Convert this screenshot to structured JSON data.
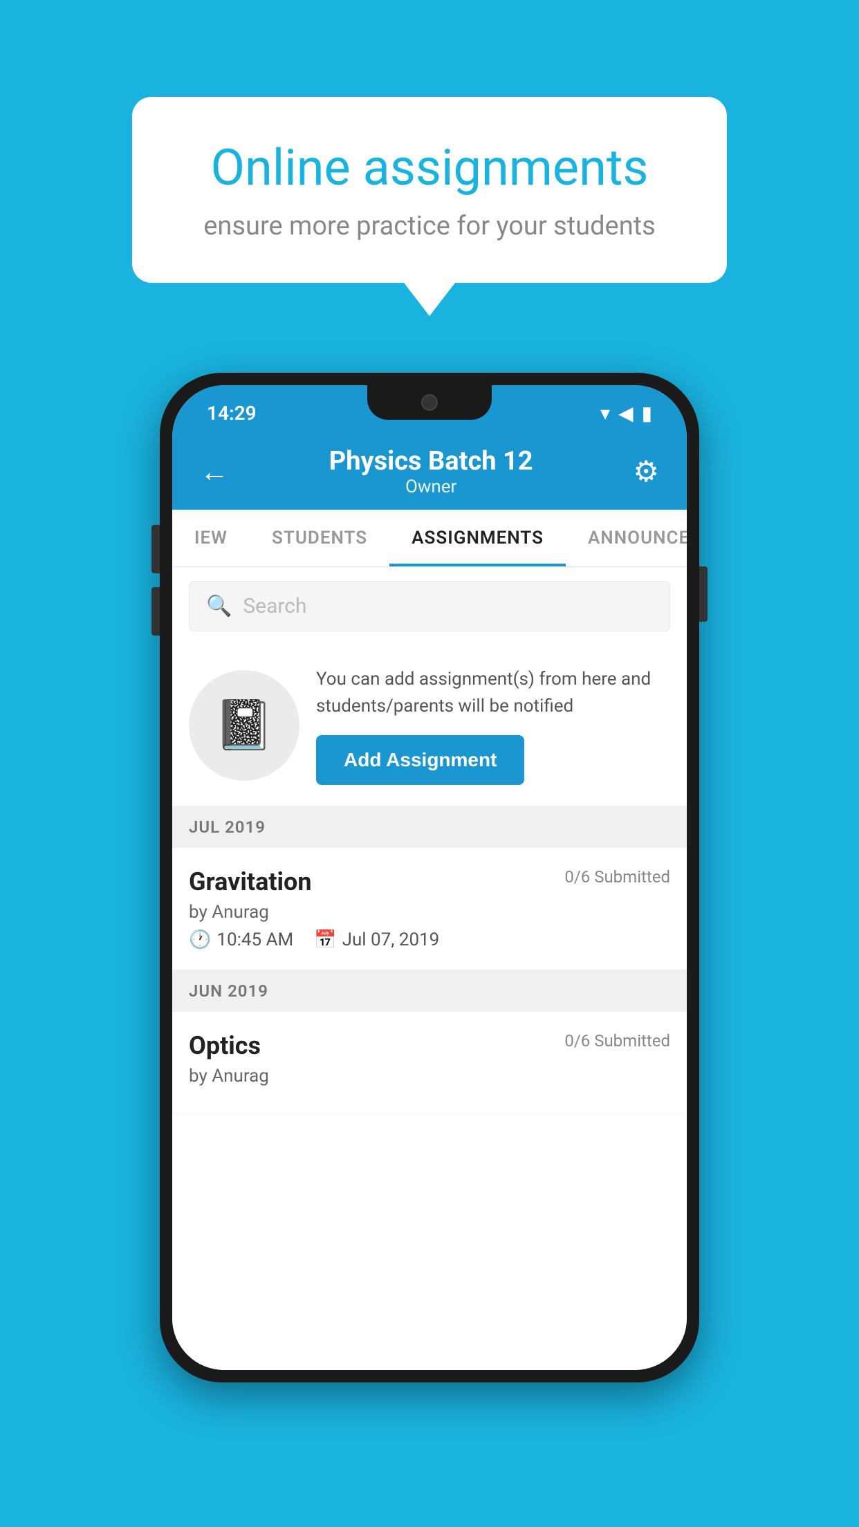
{
  "background": {
    "color": "#1ab3e0"
  },
  "promo": {
    "title": "Online assignments",
    "subtitle": "ensure more practice for your students"
  },
  "phone": {
    "status_bar": {
      "time": "14:29",
      "icons": [
        "wifi",
        "signal",
        "battery"
      ]
    },
    "header": {
      "title": "Physics Batch 12",
      "subtitle": "Owner",
      "back_label": "←",
      "settings_label": "⚙"
    },
    "tabs": [
      {
        "label": "IEW",
        "active": false
      },
      {
        "label": "STUDENTS",
        "active": false
      },
      {
        "label": "ASSIGNMENTS",
        "active": true
      },
      {
        "label": "ANNOUNCEM…",
        "active": false
      }
    ],
    "search": {
      "placeholder": "Search"
    },
    "promo_card": {
      "description": "You can add assignment(s) from here and students/parents will be notified",
      "button_label": "Add Assignment"
    },
    "sections": [
      {
        "month": "JUL 2019",
        "assignments": [
          {
            "name": "Gravitation",
            "submitted": "0/6 Submitted",
            "by": "by Anurag",
            "time": "10:45 AM",
            "date": "Jul 07, 2019"
          }
        ]
      },
      {
        "month": "JUN 2019",
        "assignments": [
          {
            "name": "Optics",
            "submitted": "0/6 Submitted",
            "by": "by Anurag",
            "time": "",
            "date": ""
          }
        ]
      }
    ]
  }
}
